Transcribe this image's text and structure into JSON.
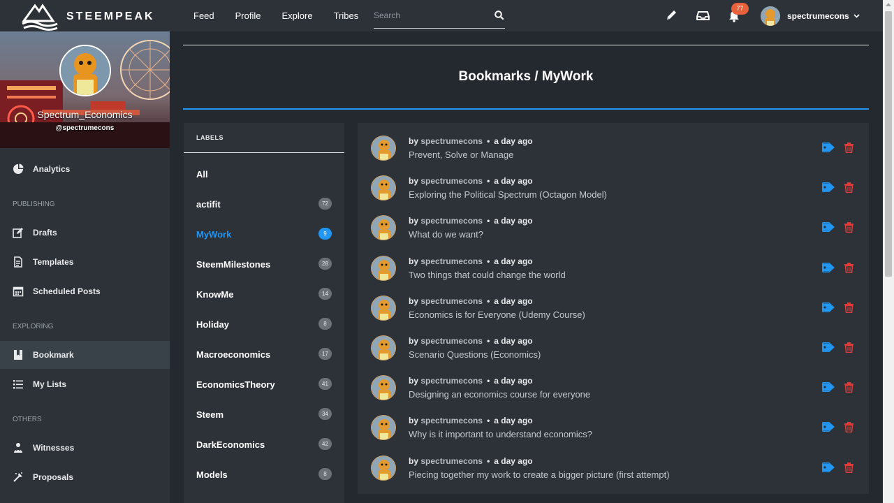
{
  "app": {
    "brand": "STEEMPEAK",
    "nav": [
      "Feed",
      "Profile",
      "Explore",
      "Tribes"
    ],
    "search_placeholder": "Search",
    "notifications_count": "77",
    "username": "spectrumecons",
    "icons": [
      "edit-icon",
      "inbox-icon",
      "bell-icon",
      "chevron-down-icon",
      "search-icon"
    ]
  },
  "sidebar": {
    "profile_name": "Spectrum_Economics",
    "profile_handle": "@spectrumecons",
    "items_top": [
      {
        "label": "Analytics",
        "icon": "pie-chart-icon"
      }
    ],
    "section_publishing": "PUBLISHING",
    "items_publishing": [
      {
        "label": "Drafts",
        "icon": "edit-icon"
      },
      {
        "label": "Templates",
        "icon": "document-icon"
      },
      {
        "label": "Scheduled Posts",
        "icon": "calendar-icon"
      }
    ],
    "section_exploring": "EXPLORING",
    "items_exploring": [
      {
        "label": "Bookmark",
        "icon": "bookmark-icon",
        "active": true
      },
      {
        "label": "My Lists",
        "icon": "list-icon"
      }
    ],
    "section_others": "OTHERS",
    "items_others": [
      {
        "label": "Witnesses",
        "icon": "witness-icon"
      },
      {
        "label": "Proposals",
        "icon": "proposals-icon"
      }
    ]
  },
  "page": {
    "title": "Bookmarks / MyWork"
  },
  "labels": {
    "heading": "LABELS",
    "items": [
      {
        "name": "All",
        "count": ""
      },
      {
        "name": "actifit",
        "count": "72"
      },
      {
        "name": "MyWork",
        "count": "9",
        "active": true
      },
      {
        "name": "SteemMilestones",
        "count": "28"
      },
      {
        "name": "KnowMe",
        "count": "14"
      },
      {
        "name": "Holiday",
        "count": "8"
      },
      {
        "name": "Macroeconomics",
        "count": "17"
      },
      {
        "name": "EconomicsTheory",
        "count": "41"
      },
      {
        "name": "Steem",
        "count": "34"
      },
      {
        "name": "DarkEconomics",
        "count": "42"
      },
      {
        "name": "Models",
        "count": "8"
      }
    ]
  },
  "posts": [
    {
      "by": "by",
      "author": "spectrumecons",
      "time": "a day ago",
      "title": "Prevent, Solve or Manage"
    },
    {
      "by": "by",
      "author": "spectrumecons",
      "time": "a day ago",
      "title": "Exploring the Political Spectrum (Octagon Model)"
    },
    {
      "by": "by",
      "author": "spectrumecons",
      "time": "a day ago",
      "title": "What do we want?"
    },
    {
      "by": "by",
      "author": "spectrumecons",
      "time": "a day ago",
      "title": "Two things that could change the world"
    },
    {
      "by": "by",
      "author": "spectrumecons",
      "time": "a day ago",
      "title": "Economics is for Everyone (Udemy Course)"
    },
    {
      "by": "by",
      "author": "spectrumecons",
      "time": "a day ago",
      "title": "Scenario Questions (Economics)"
    },
    {
      "by": "by",
      "author": "spectrumecons",
      "time": "a day ago",
      "title": "Designing an economics course for everyone"
    },
    {
      "by": "by",
      "author": "spectrumecons",
      "time": "a day ago",
      "title": "Why is it important to understand economics?"
    },
    {
      "by": "by",
      "author": "spectrumecons",
      "time": "a day ago",
      "title": "Piecing together my work to create a bigger picture (first attempt)"
    }
  ],
  "colors": {
    "accent": "#2196f3",
    "danger": "#e53935",
    "badge": "#e8613a",
    "background": "#23292f",
    "panel": "#2c3238"
  }
}
